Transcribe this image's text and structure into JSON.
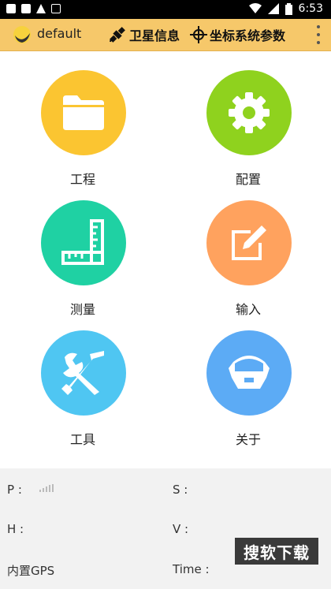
{
  "status_bar": {
    "time": "6:53"
  },
  "app_bar": {
    "title": "default",
    "satellite_info": "卫星信息",
    "coordinate_params": "坐标系统参数"
  },
  "menu": [
    {
      "label": "工程",
      "icon": "folder-icon",
      "color": "#fbc531"
    },
    {
      "label": "配置",
      "icon": "gear-icon",
      "color": "#8fd21e"
    },
    {
      "label": "测量",
      "icon": "ruler-icon",
      "color": "#1fd1a3"
    },
    {
      "label": "输入",
      "icon": "edit-icon",
      "color": "#ffa25e"
    },
    {
      "label": "工具",
      "icon": "tools-icon",
      "color": "#4fc6f2"
    },
    {
      "label": "关于",
      "icon": "receiver-icon",
      "color": "#5cabf5"
    }
  ],
  "info": {
    "p_label": "P :",
    "s_label": "S :",
    "h_label": "H :",
    "v_label": "V :",
    "source_label": "内置GPS",
    "time_label": "Time :"
  },
  "watermark": "搜软下载"
}
